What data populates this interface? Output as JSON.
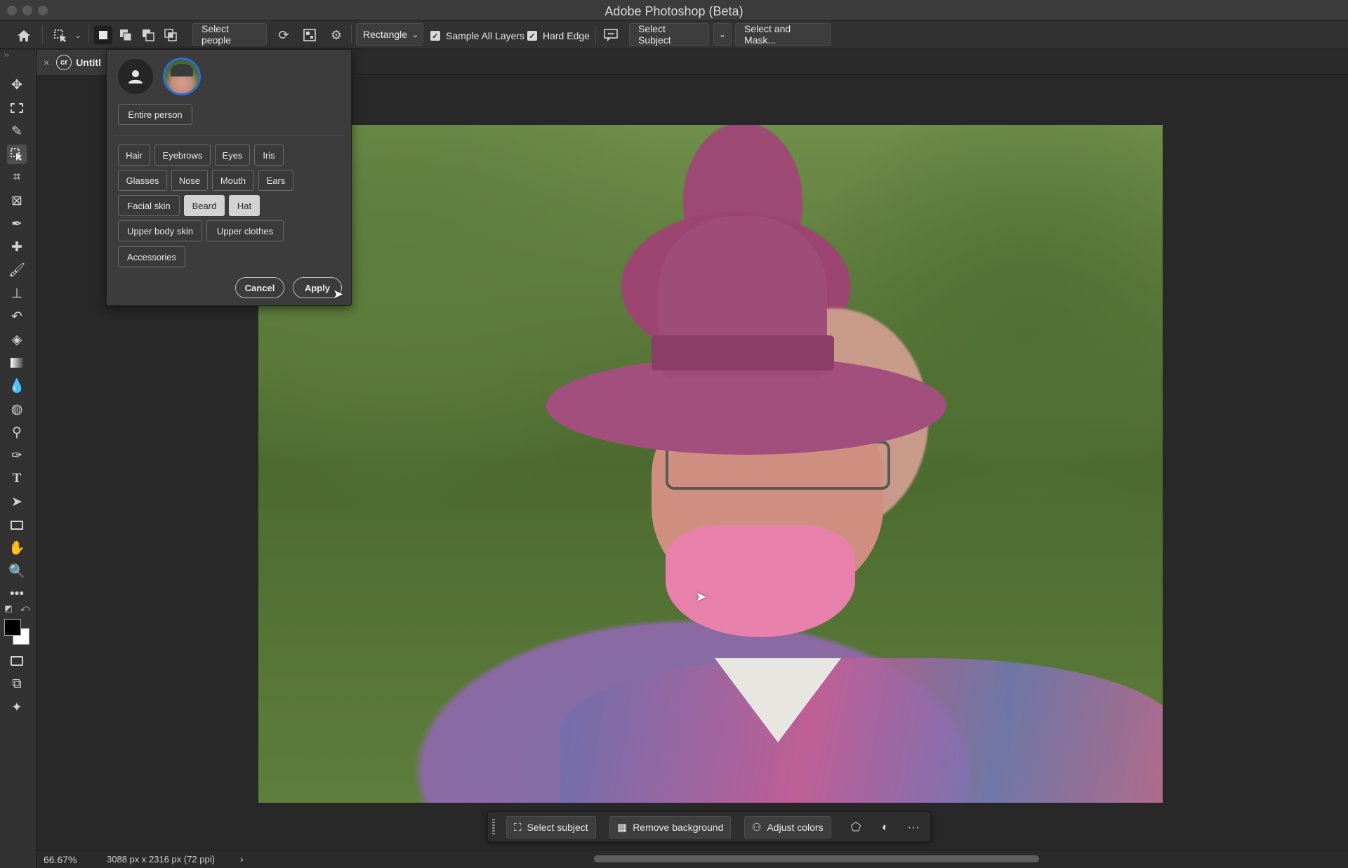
{
  "window": {
    "title": "Adobe Photoshop (Beta)"
  },
  "options_bar": {
    "select_people_label": "Select people",
    "shape_mode": "Rectangle",
    "sample_all_layers_label": "Sample All Layers",
    "sample_all_layers_checked": true,
    "hard_edge_label": "Hard Edge",
    "hard_edge_checked": true,
    "select_subject_label": "Select Subject",
    "select_and_mask_label": "Select and Mask..."
  },
  "document_tab": {
    "title": "Untitl"
  },
  "people_popup": {
    "entire_person_label": "Entire person",
    "parts": [
      {
        "label": "Hair",
        "selected": false
      },
      {
        "label": "Eyebrows",
        "selected": false
      },
      {
        "label": "Eyes",
        "selected": false
      },
      {
        "label": "Iris",
        "selected": false
      },
      {
        "label": "Glasses",
        "selected": false
      },
      {
        "label": "Nose",
        "selected": false
      },
      {
        "label": "Mouth",
        "selected": false
      },
      {
        "label": "Ears",
        "selected": false
      },
      {
        "label": "Facial skin",
        "selected": false
      },
      {
        "label": "Beard",
        "selected": true
      },
      {
        "label": "Hat",
        "selected": true
      },
      {
        "label": "Upper body skin",
        "selected": false
      },
      {
        "label": "Upper clothes",
        "selected": false
      },
      {
        "label": "Accessories",
        "selected": false
      }
    ],
    "cancel_label": "Cancel",
    "apply_label": "Apply"
  },
  "task_bar": {
    "select_subject_label": "Select subject",
    "remove_background_label": "Remove background",
    "adjust_colors_label": "Adjust colors",
    "more_label": "···"
  },
  "status_bar": {
    "zoom": "66.67%",
    "doc_info": "3088 px x 2316 px (72 ppi)"
  },
  "colors": {
    "accent": "#2a6fd6",
    "selection_overlay": "#e880ac"
  }
}
